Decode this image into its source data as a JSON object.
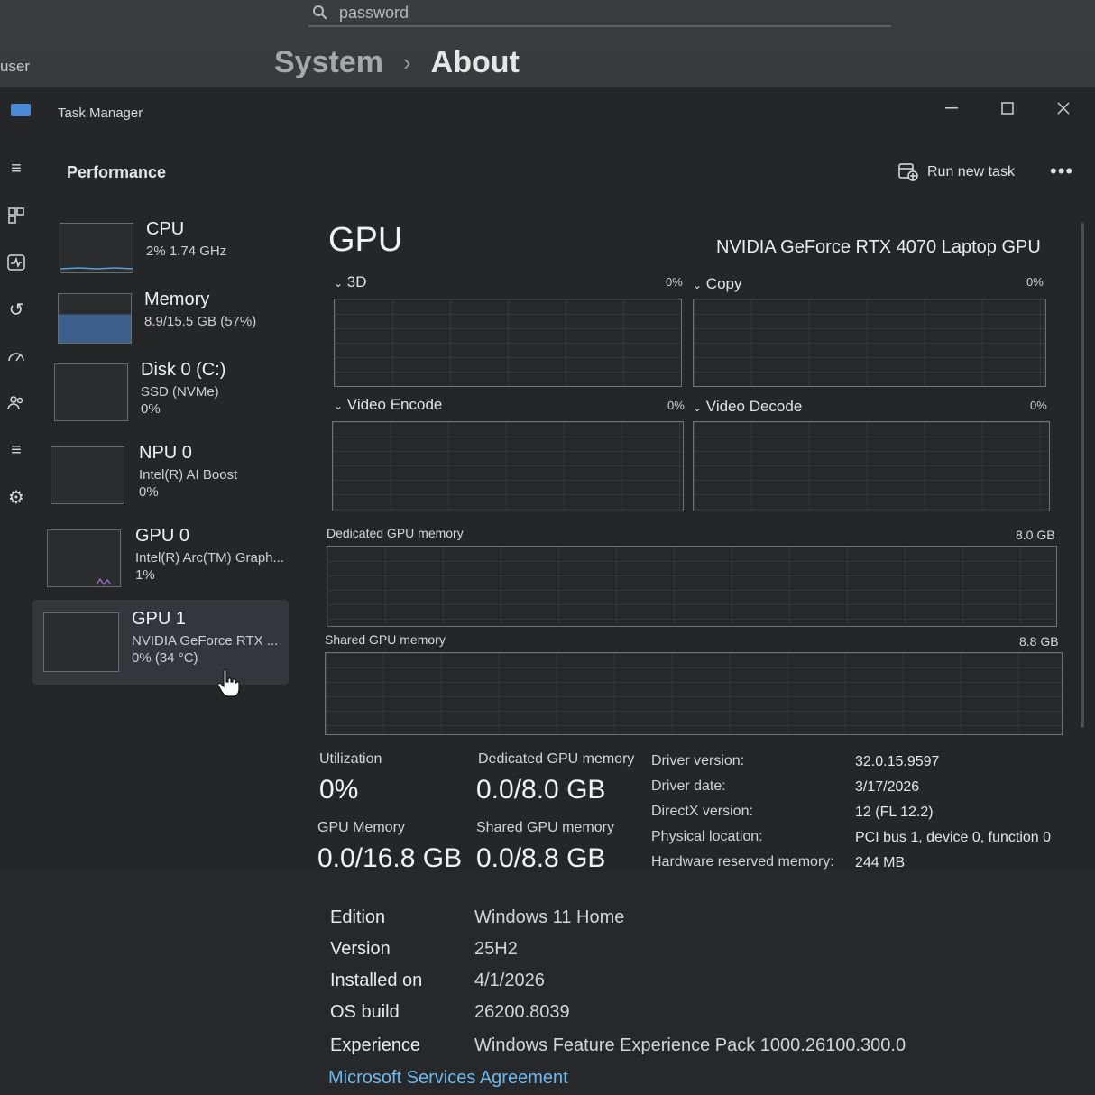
{
  "settings": {
    "search_placeholder": "password",
    "user_label": "user",
    "breadcrumb": {
      "parent": "System",
      "current": "About"
    }
  },
  "task_manager": {
    "title": "Task Manager",
    "section": "Performance",
    "run_new_task": "Run new task",
    "devices": [
      {
        "name": "CPU",
        "line1": "2%  1.74 GHz",
        "line2": ""
      },
      {
        "name": "Memory",
        "line1": "8.9/15.5 GB (57%)",
        "line2": ""
      },
      {
        "name": "Disk 0 (C:)",
        "line1": "SSD (NVMe)",
        "line2": "0%"
      },
      {
        "name": "NPU 0",
        "line1": "Intel(R) AI Boost",
        "line2": "0%"
      },
      {
        "name": "GPU 0",
        "line1": "Intel(R) Arc(TM) Graph...",
        "line2": "1%"
      },
      {
        "name": "GPU 1",
        "line1": "NVIDIA GeForce RTX ...",
        "line2": "0%  (34 °C)"
      }
    ],
    "gpu": {
      "title": "GPU",
      "model": "NVIDIA GeForce RTX 4070 Laptop GPU",
      "engines": [
        {
          "label": "3D",
          "pct": "0%"
        },
        {
          "label": "Copy",
          "pct": "0%"
        },
        {
          "label": "Video Encode",
          "pct": "0%"
        },
        {
          "label": "Video Decode",
          "pct": "0%"
        }
      ],
      "dedicated_memory": {
        "label": "Dedicated GPU memory",
        "max": "8.0 GB"
      },
      "shared_memory": {
        "label": "Shared GPU memory",
        "max": "8.8 GB"
      },
      "stats": {
        "utilization_label": "Utilization",
        "utilization": "0%",
        "dedicated_label": "Dedicated GPU memory",
        "dedicated": "0.0/8.0 GB",
        "gpu_memory_label": "GPU Memory",
        "gpu_memory": "0.0/16.8 GB",
        "shared_label": "Shared GPU memory",
        "shared": "0.0/8.8 GB"
      },
      "details": [
        {
          "key": "Driver version:",
          "value": "32.0.15.9597"
        },
        {
          "key": "Driver date:",
          "value": "3/17/2026"
        },
        {
          "key": "DirectX version:",
          "value": "12 (FL 12.2)"
        },
        {
          "key": "Physical location:",
          "value": "PCI bus 1, device 0, function 0"
        },
        {
          "key": "Hardware reserved memory:",
          "value": "244 MB"
        }
      ]
    }
  },
  "about": {
    "rows": [
      {
        "key": "Edition",
        "value": "Windows 11 Home"
      },
      {
        "key": "Version",
        "value": "25H2"
      },
      {
        "key": "Installed on",
        "value": "4/1/2026"
      },
      {
        "key": "OS build",
        "value": "26200.8039"
      },
      {
        "key": "Experience",
        "value": "Windows Feature Experience Pack 1000.26100.300.0"
      }
    ],
    "link": "Microsoft Services Agreement"
  },
  "colors": {
    "accent_link": "#6fb8ee",
    "memory_fill": "#3e5f8c"
  }
}
